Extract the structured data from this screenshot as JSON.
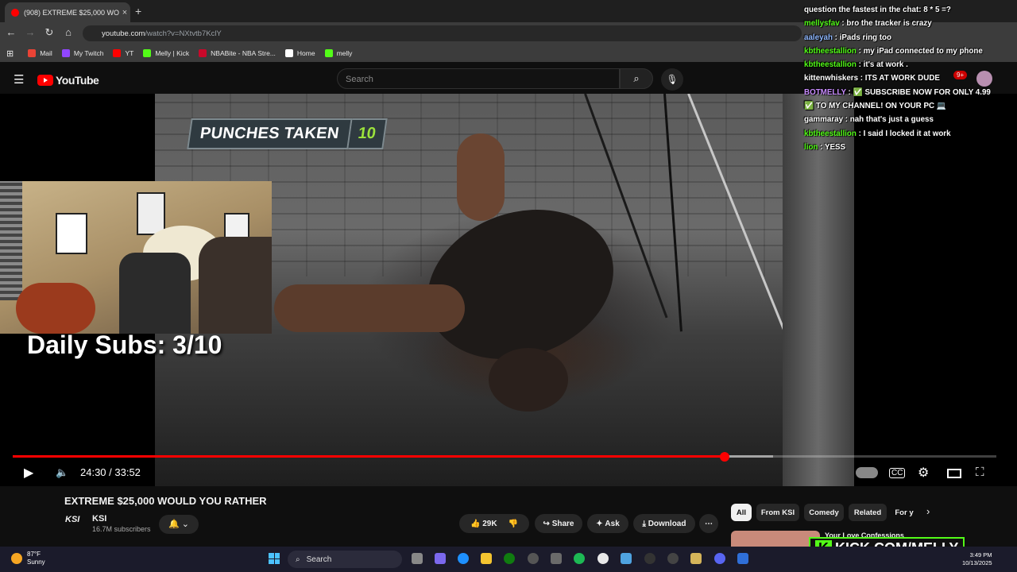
{
  "browser": {
    "tab_title": "(908) EXTREME $25,000 WOULD...",
    "tab_close": "×",
    "new_tab": "+",
    "url_host": "youtube.com",
    "url_path": "/watch?v=NXtvtb7KclY",
    "bookmarks": [
      {
        "label": "Mail",
        "color": "#ea4335"
      },
      {
        "label": "My Twitch",
        "color": "#9146ff"
      },
      {
        "label": "YT",
        "color": "#ff0000"
      },
      {
        "label": "Melly | Kick",
        "color": "#53fc18"
      },
      {
        "label": "NBABite - NBA Stre...",
        "color": "#c9082a"
      },
      {
        "label": "Home",
        "color": "#ffffff"
      },
      {
        "label": "melly",
        "color": "#53fc18"
      }
    ]
  },
  "youtube": {
    "logo": "YouTube",
    "search_placeholder": "Search",
    "notif_count": "9+",
    "video": {
      "punches_label": "PUNCHES TAKEN",
      "punches_count": "10",
      "overlay_daily": "Daily Subs: 3/10",
      "time": "24:30 / 33:52",
      "progress": 0.724,
      "buffered": 0.773
    },
    "title": "EXTREME $25,000 WOULD YOU RATHER",
    "channel": {
      "avatar": "KSI",
      "name": "KSI",
      "subs": "16.7M subscribers"
    },
    "actions": {
      "likes": "29K",
      "share": "Share",
      "ask": "Ask",
      "download": "Download",
      "more": "⋯"
    },
    "chips": [
      "All",
      "From KSI",
      "Comedy",
      "Related",
      "For y"
    ],
    "suggestion_title": "Your Love Confessions"
  },
  "chat": [
    {
      "user": "",
      "text": "question the fastest in the chat: 8 * 5 =?",
      "color": "#ffffff"
    },
    {
      "user": "mellysfav",
      "text": "bro the tracker is crazy",
      "color": "#53fc18"
    },
    {
      "user": "aaleyah",
      "text": "iPads ring too",
      "color": "#8fb8ff"
    },
    {
      "user": "kbtheestallion",
      "text": "my iPad connected to my phone",
      "color": "#53fc18"
    },
    {
      "user": "kbtheestallion",
      "text": "it's at work .",
      "color": "#53fc18"
    },
    {
      "user": "kittenwhiskers",
      "text": "ITS AT WORK DUDE",
      "color": "#ffffff"
    },
    {
      "user": "BOTMELLY",
      "text": "✅ SUBSCRIBE NOW FOR ONLY 4.99",
      "color": "#c98cff"
    },
    {
      "user": "",
      "text": "✅ TO MY CHANNEL! ON YOUR PC 💻",
      "color": "#ffffff"
    },
    {
      "user": "gammaray",
      "text": "nah that's just a guess",
      "color": "#ffffff"
    },
    {
      "user": "kbtheestallion",
      "text": "I said I locked it at work",
      "color": "#53fc18"
    },
    {
      "user": "lion",
      "text": "YESS",
      "color": "#53fc18"
    }
  ],
  "kick": {
    "k": "K",
    "url": "KICK.COM/MELLY"
  },
  "taskbar": {
    "temp": "87°F",
    "weather": "Sunny",
    "search": "Search",
    "time": "3:49 PM",
    "date": "10/13/2025"
  }
}
